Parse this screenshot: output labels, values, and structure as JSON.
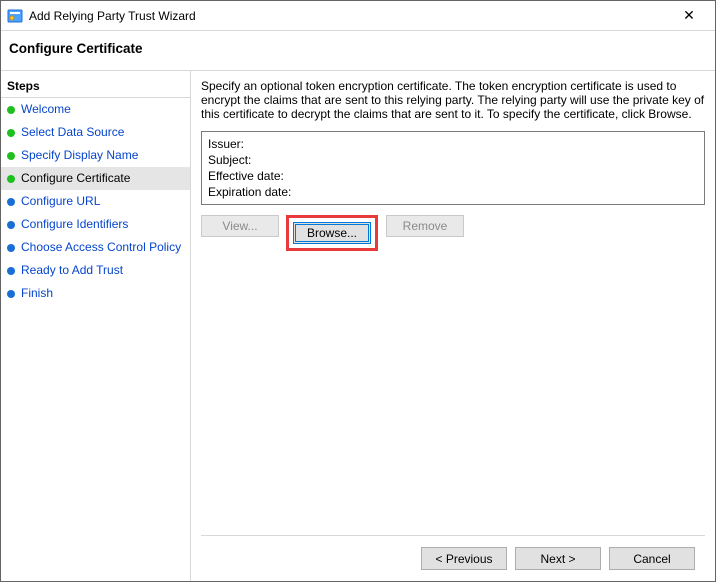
{
  "window": {
    "title": "Add Relying Party Trust Wizard",
    "close_glyph": "✕"
  },
  "header": {
    "title": "Configure Certificate"
  },
  "sidebar": {
    "title": "Steps",
    "items": [
      {
        "label": "Welcome",
        "state": "done"
      },
      {
        "label": "Select Data Source",
        "state": "done"
      },
      {
        "label": "Specify Display Name",
        "state": "done"
      },
      {
        "label": "Configure Certificate",
        "state": "current"
      },
      {
        "label": "Configure URL",
        "state": "pending"
      },
      {
        "label": "Configure Identifiers",
        "state": "pending"
      },
      {
        "label": "Choose Access Control Policy",
        "state": "pending"
      },
      {
        "label": "Ready to Add Trust",
        "state": "pending"
      },
      {
        "label": "Finish",
        "state": "pending"
      }
    ]
  },
  "content": {
    "description": "Specify an optional token encryption certificate.  The token encryption certificate is used to encrypt the claims that are sent to this relying party.  The relying party will use the private key of this certificate to decrypt the claims that are sent to it.  To specify the certificate, click Browse.",
    "cert": {
      "issuer_label": "Issuer:",
      "issuer_value": "",
      "subject_label": "Subject:",
      "subject_value": "",
      "effective_label": "Effective date:",
      "effective_value": "",
      "expiration_label": "Expiration date:",
      "expiration_value": ""
    },
    "buttons": {
      "view": "View...",
      "browse": "Browse...",
      "remove": "Remove"
    }
  },
  "footer": {
    "previous": "< Previous",
    "next": "Next >",
    "cancel": "Cancel"
  }
}
